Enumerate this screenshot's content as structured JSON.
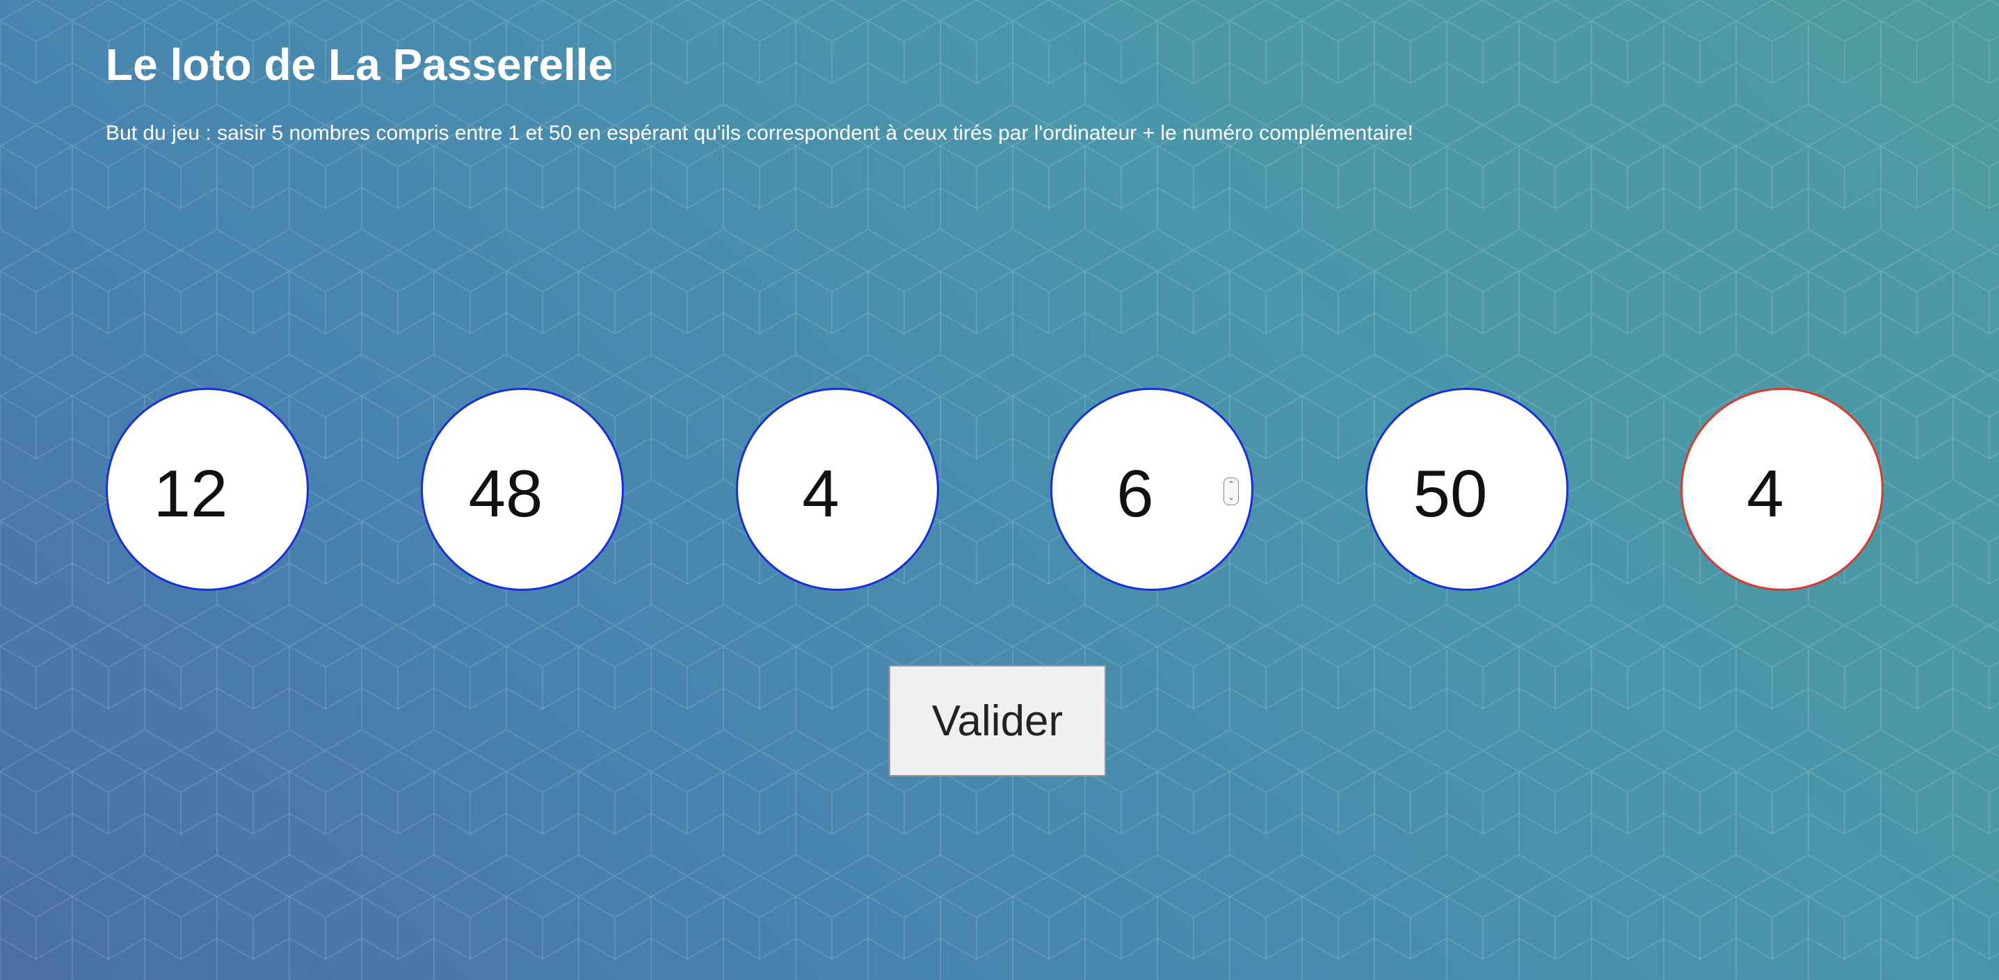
{
  "header": {
    "title": "Le loto de La Passerelle",
    "description": "But du jeu : saisir 5 nombres compris entre 1 et 50 en espérant qu'ils correspondent à ceux tirés par l'ordinateur + le numéro complémentaire!"
  },
  "balls": [
    {
      "value": "12"
    },
    {
      "value": "48"
    },
    {
      "value": "4"
    },
    {
      "value": "6"
    },
    {
      "value": "50"
    }
  ],
  "complementary": {
    "value": "4"
  },
  "submit_label": "Valider",
  "colors": {
    "ball_border": "#1a2fd6",
    "complementary_border": "#d83a2c",
    "background_start": "#4a6fa5",
    "background_end": "#4e9b9f"
  },
  "icons": {
    "background": "cube-pattern",
    "stepper": "spinner-arrows-icon"
  }
}
